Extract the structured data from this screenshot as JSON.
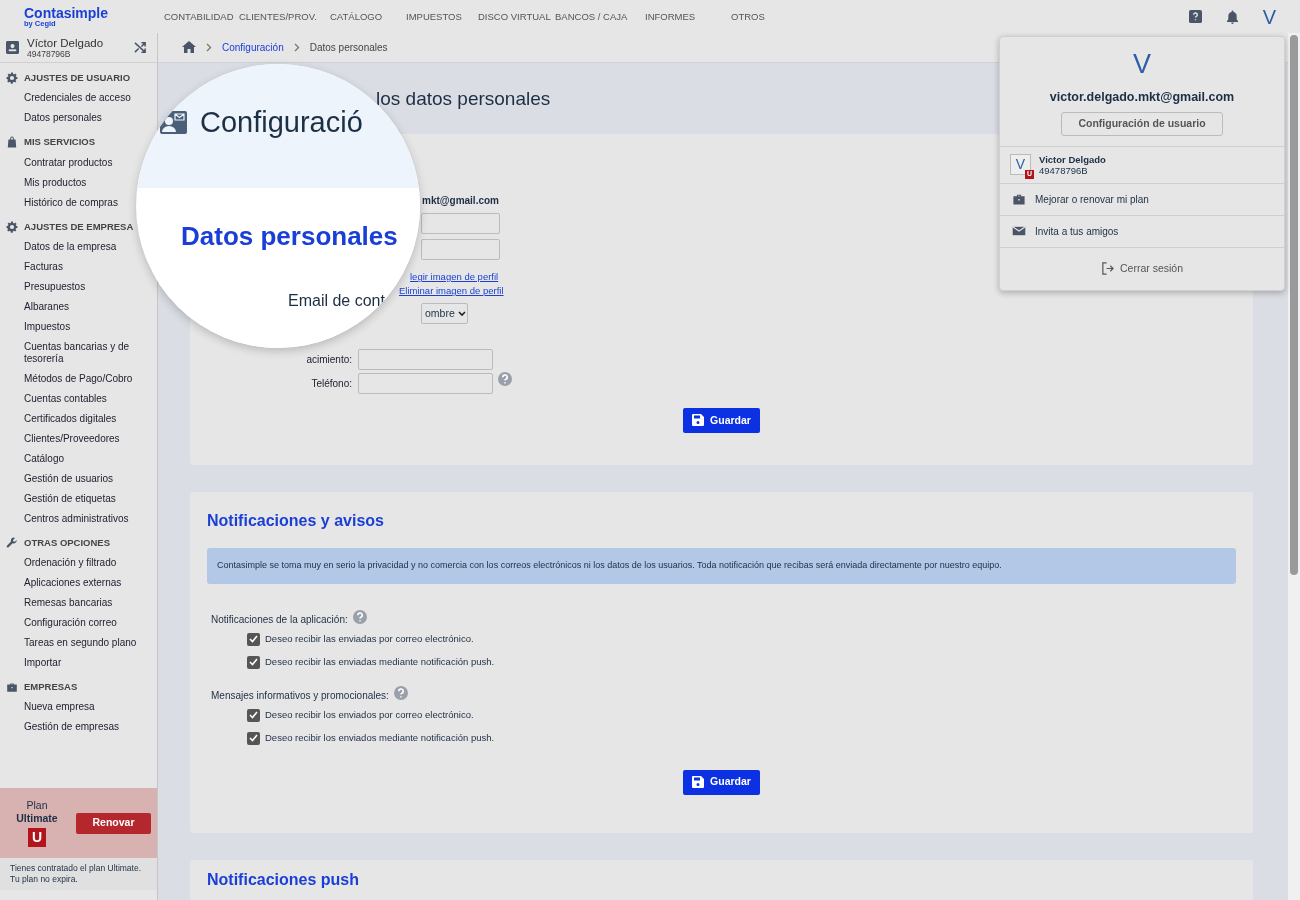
{
  "top_nav": {
    "logo": "Contasimple",
    "logo_sub": "by Cegid",
    "menu": [
      "CONTABILIDAD",
      "CLIENTES/PROV.",
      "CATÁLOGO",
      "IMPUESTOS",
      "DISCO VIRTUAL",
      "BANCOS / CAJA",
      "INFORMES",
      "OTROS"
    ],
    "avatar": "V"
  },
  "sidebar": {
    "user_name": "Víctor Delgado",
    "user_id": "49478796B",
    "sections": [
      {
        "title": "AJUSTES DE USUARIO",
        "items": [
          "Credenciales de acceso",
          "Datos personales"
        ]
      },
      {
        "title": "MIS SERVICIOS",
        "items": [
          "Contratar productos",
          "Mis productos",
          "Histórico de compras"
        ]
      },
      {
        "title": "AJUSTES DE EMPRESA",
        "items": [
          "Datos de la empresa",
          "Facturas",
          "Presupuestos",
          "Albaranes",
          "Impuestos",
          "Cuentas bancarias y de tesorería",
          "Métodos de Pago/Cobro",
          "Cuentas contables",
          "Certificados digitales",
          "Clientes/Proveedores",
          "Catálogo",
          "Gestión de usuarios",
          "Gestión de etiquetas",
          "Centros administrativos"
        ]
      },
      {
        "title": "OTRAS OPCIONES",
        "items": [
          "Ordenación y filtrado",
          "Aplicaciones externas",
          "Remesas bancarias",
          "Configuración correo",
          "Tareas en segundo plano",
          "Importar"
        ]
      },
      {
        "title": "EMPRESAS",
        "items": [
          "Nueva empresa",
          "Gestión de empresas"
        ]
      }
    ],
    "plan": {
      "label": "Plan",
      "name": "Ultimate",
      "badge": "U",
      "button": "Renovar",
      "note": [
        "Tienes contratado el plan Ultimate.",
        "Tu plan no expira."
      ]
    }
  },
  "breadcrumb": [
    "Configuración",
    "Datos personales"
  ],
  "page_title": "los datos personales",
  "magnifier": {
    "title": "Configuració",
    "section": "Datos personales",
    "label": "Email de cont"
  },
  "personal_form": {
    "email": "mkt@gmail.com",
    "choose_image_link": "legir imagen de perfil",
    "remove_image_link": "Eliminar imagen de perfil",
    "gender": "ombre",
    "birth_label": "acimiento:",
    "phone_label": "Teléfono:",
    "save": "Guardar"
  },
  "notifications": {
    "title": "Notificaciones y avisos",
    "notice": "Contasimple se toma muy en serio la privacidad y no comercia con los correos electrónicos ni los datos de los usuarios. Toda notificación que recibas será enviada directamente por nuestro equipo.",
    "groups": [
      {
        "label": "Notificaciones de la aplicación:",
        "options": [
          {
            "label": "Deseo recibir las enviadas por correo electrónico.",
            "checked": true
          },
          {
            "label": "Deseo recibir las enviadas mediante notificación push.",
            "checked": true
          }
        ]
      },
      {
        "label": "Mensajes informativos y promocionales:",
        "options": [
          {
            "label": "Deseo recibir los enviados por correo electrónico.",
            "checked": true
          },
          {
            "label": "Deseo recibir los enviados mediante notificación push.",
            "checked": true
          }
        ]
      }
    ],
    "save": "Guardar"
  },
  "push_section": {
    "title": "Notificaciones push"
  },
  "user_menu": {
    "avatar": "V",
    "email": "victor.delgado.mkt@gmail.com",
    "settings_button": "Configuración de usuario",
    "account": {
      "letter": "V",
      "badge": "U",
      "name": "Victor Delgado",
      "id": "49478796B"
    },
    "items": [
      "Mejorar o renovar mi plan",
      "Invita a tus amigos"
    ],
    "logout": "Cerrar sesión"
  }
}
